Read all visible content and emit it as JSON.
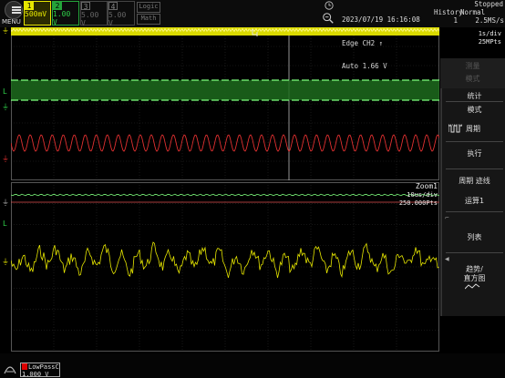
{
  "top": {
    "menu_label": "MENU",
    "ch1": {
      "num": "1",
      "scale": "500mV"
    },
    "ch2": {
      "num": "2",
      "scale": "1.00 V"
    },
    "ch3": {
      "num": "3",
      "scale": "5.00 V"
    },
    "ch4": {
      "num": "4",
      "scale": "5.00 V"
    },
    "logic_label": "Logic",
    "math_label": "Math",
    "datetime": "2023/07/19 16:16:08",
    "trigger_line1": "Edge CH2 ↑",
    "trigger_line2": "Auto 1.66 V",
    "history_label": "History",
    "history_value": "1",
    "acq_mode": "Normal",
    "sample_rate": "2.5MS/s",
    "status": "Stopped"
  },
  "main": {
    "timebase": "1s/div",
    "points": "25MPts"
  },
  "zoom": {
    "title": "Zoom1",
    "timebase": "10us/div",
    "points": "250.000Pts"
  },
  "menu": {
    "faded_top": "测量",
    "faded_sub": "模式",
    "title": "统计",
    "mode_label": "模式",
    "period_label": "周期",
    "execute_label": "执行",
    "period_trace_label": "周期 迹线",
    "math_label": "运算1",
    "list_label": "列表",
    "trend_label": "趋势/",
    "histogram_label": "直方图"
  },
  "bottom": {
    "lowpass_label": "LowPass",
    "lowpass_tag": "C",
    "lowpass_value": "1.000 V"
  },
  "colors": {
    "ch1": "#e6e600",
    "ch2": "#25a33a",
    "ch3_red": "#e03030",
    "background": "#000000",
    "grid": "#2a2a2a"
  }
}
